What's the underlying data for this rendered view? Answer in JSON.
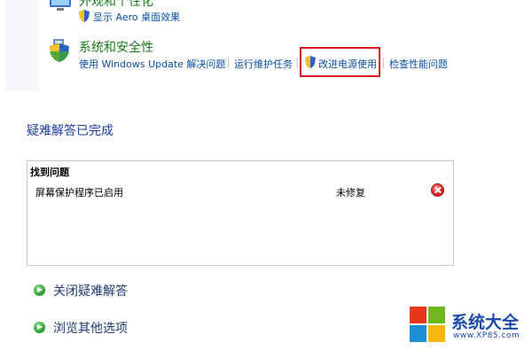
{
  "control_panel": {
    "appearance_title": "外观和个性化",
    "appearance_links": [
      "显示 Aero 桌面效果"
    ],
    "security_title": "系统和安全性",
    "security_links": [
      "使用 Windows Update 解决问题",
      "运行维护任务",
      "改进电源使用",
      "检查性能问题"
    ]
  },
  "troubleshooting": {
    "title": "疑难解答已完成",
    "problems_header": "找到问题",
    "problems": [
      {
        "name": "屏幕保护程序已启用",
        "status": "未修复",
        "icon": "error-x-icon"
      }
    ],
    "actions": [
      {
        "label": "关闭疑难解答",
        "icon": "green-arrow-icon"
      },
      {
        "label": "浏览其他选项",
        "icon": "green-arrow-icon"
      }
    ]
  },
  "watermark": {
    "name": "系统大全",
    "url": "www.XP85.com",
    "colors": [
      "#e8381b",
      "#6fb71c",
      "#1c8fd6",
      "#f5b70b"
    ]
  },
  "colors": {
    "category_green": "#1a7a1a",
    "link_blue": "#0b4ea2",
    "highlight_red": "#d41a1a"
  }
}
